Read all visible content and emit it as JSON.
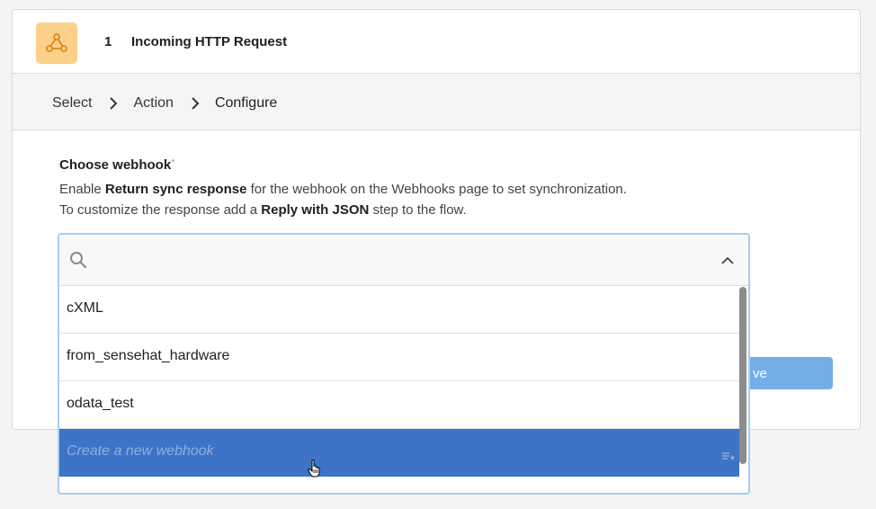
{
  "step": {
    "number": "1",
    "title": "Incoming HTTP Request",
    "icon": "webhook-icon",
    "icon_bg": "#fbd08a"
  },
  "breadcrumb": [
    "Select",
    "Action",
    "Configure"
  ],
  "field": {
    "label": "Choose webhook",
    "required_mark": "*",
    "help_line1_pre": "Enable ",
    "help_line1_bold": "Return sync response",
    "help_line1_post": " for the webhook on the Webhooks page to set synchronization.",
    "help_line2_pre": "To customize the response add a ",
    "help_line2_bold": "Reply with JSON",
    "help_line2_post": " step to the flow."
  },
  "dropdown": {
    "search_placeholder": "",
    "options": [
      "cXML",
      "from_sensehat_hardware",
      "odata_test"
    ],
    "create_label": "Create a new webhook",
    "highlight_color": "#3d74c7"
  },
  "save_button": {
    "label_visible": "ve",
    "color": "#74aee8"
  }
}
